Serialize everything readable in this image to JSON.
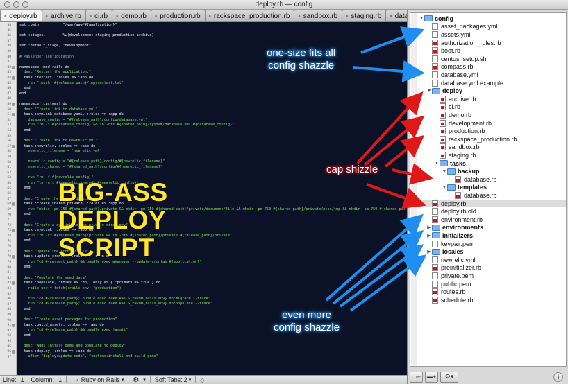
{
  "window": {
    "title": "deploy.rb — config"
  },
  "tabs": [
    {
      "label": "deploy.rb",
      "active": true
    },
    {
      "label": "archive.rb"
    },
    {
      "label": "ci.rb"
    },
    {
      "label": "demo.rb"
    },
    {
      "label": "production.rb"
    },
    {
      "label": "rackspace_production.rb"
    },
    {
      "label": "sandbox.rb"
    },
    {
      "label": "staging.rb"
    },
    {
      "label": "database.rb"
    }
  ],
  "editor": {
    "overlay": [
      "BIG-ASS",
      "DEPLOY",
      "SCRIPT"
    ],
    "lines": [
      {
        "n": "34",
        "text": "set :path,          \"/var/www/#{application}\"",
        "cls": "kw"
      },
      {
        "n": "35",
        "text": "",
        "cls": "kw"
      },
      {
        "n": "36",
        "text": "set :stages,        %w(development staging production archive)",
        "cls": "kw"
      },
      {
        "n": "37",
        "text": "",
        "cls": "kw"
      },
      {
        "n": "38",
        "text": "set :default_stage, \"development\"",
        "cls": "kw"
      },
      {
        "n": "39",
        "text": "",
        "cls": "kw"
      },
      {
        "n": "40",
        "text": "# Passenger Configuration",
        "cls": "cm"
      },
      {
        "n": "41",
        "text": "",
        "cls": "kw"
      },
      {
        "n": "42",
        "text": "namespace :mod_rails do",
        "cls": "kw",
        "fold": true
      },
      {
        "n": "43",
        "text": "  desc \"Restart the application.\"",
        "cls": "st"
      },
      {
        "n": "44",
        "text": "  task :restart, :roles => :app do",
        "cls": "kw",
        "fold": true
      },
      {
        "n": "45",
        "text": "    run \"touch  #{release_path}/tmp/restart.txt\"",
        "cls": "st"
      },
      {
        "n": "46",
        "text": "  end",
        "cls": "kw"
      },
      {
        "n": "47",
        "text": "end",
        "cls": "kw"
      },
      {
        "n": "48",
        "text": "",
        "cls": "kw"
      },
      {
        "n": "49",
        "text": "namespace(:customs) do",
        "cls": "kw",
        "fold": true
      },
      {
        "n": "50",
        "text": "  desc \"Create link to database.yml\"",
        "cls": "st"
      },
      {
        "n": "51",
        "text": "  task :symlink_database_yaml, :roles => :app do",
        "cls": "kw",
        "fold": true
      },
      {
        "n": "52",
        "text": "    database_config = \"#{release_path}/config/database.yml\"",
        "cls": "st"
      },
      {
        "n": "53",
        "text": "    run \"rm -f #{database_config} && ln -nfs #{shared_path}/system/database.yml #{database_config}\"",
        "cls": "st"
      },
      {
        "n": "54",
        "text": "  end",
        "cls": "kw"
      },
      {
        "n": "55",
        "text": "",
        "cls": "kw"
      },
      {
        "n": "56",
        "text": "  desc \"Create link to newrelic.yml\"",
        "cls": "st"
      },
      {
        "n": "57",
        "text": "  task :newrelic, :roles => :app do",
        "cls": "kw",
        "fold": true
      },
      {
        "n": "58",
        "text": "    newrelic_filename = 'newrelic.yml'",
        "cls": "st"
      },
      {
        "n": "59",
        "text": "",
        "cls": "kw"
      },
      {
        "n": "60",
        "text": "    newrelic_config = \"#{release_path}/config/#{newrelic_filename}\"",
        "cls": "st"
      },
      {
        "n": "61",
        "text": "    newrelic_shared = \"#{shared_path}/config/#{newrelic_filename}\"",
        "cls": "st"
      },
      {
        "n": "62",
        "text": "",
        "cls": "kw"
      },
      {
        "n": "63",
        "text": "    run \"rm -f #{newrelic_config}\"",
        "cls": "st"
      },
      {
        "n": "64",
        "text": "    run \"ln -nfs #{newrelic_shared} #{newrelic_config}\"",
        "cls": "st"
      },
      {
        "n": "65",
        "text": "  end",
        "cls": "kw"
      },
      {
        "n": "66",
        "text": "",
        "cls": "kw"
      },
      {
        "n": "67",
        "text": "  desc \"Create the shared directories\"",
        "cls": "st"
      },
      {
        "n": "68",
        "text": "  task :create_shared_private, :roles => :app do",
        "cls": "kw",
        "fold": true
      },
      {
        "n": "69",
        "text": "    run \"mkdir -pm 750 #{shared_path}/private && mkdir -pm 750 #{shared_path}/private/document/file && mkdir -pm 750 #{shared_path}/private/ptos/tmp && mkdir -pm 750 #{shared_path}/private/\"",
        "cls": "st"
      },
      {
        "n": "70",
        "text": "  end",
        "cls": "kw"
      },
      {
        "n": "71",
        "text": "",
        "cls": "kw"
      },
      {
        "n": "72",
        "text": "  desc \"Create a symlink to the private directory\"",
        "cls": "st"
      },
      {
        "n": "73",
        "text": "  task :symlink, :roles => :app do",
        "cls": "kw",
        "fold": true
      },
      {
        "n": "74",
        "text": "    run \"rm -rf #{release_path}/private && ln -nfs #{shared_path}/private #{release_path}/private\"",
        "cls": "st"
      },
      {
        "n": "75",
        "text": "  end",
        "cls": "kw"
      },
      {
        "n": "76",
        "text": "",
        "cls": "kw"
      },
      {
        "n": "77",
        "text": "  desc \"Update the crontab file\"",
        "cls": "st"
      },
      {
        "n": "78",
        "text": "  task :update_crontab, :roles => :cron do",
        "cls": "kw",
        "fold": true
      },
      {
        "n": "79",
        "text": "    run \"cd #{current_path} && bundle exec whenever --update-crontab #{application}\"",
        "cls": "st"
      },
      {
        "n": "80",
        "text": "  end",
        "cls": "kw"
      },
      {
        "n": "81",
        "text": "",
        "cls": "kw"
      },
      {
        "n": "82",
        "text": "  desc \"Populate the seed data\"",
        "cls": "st"
      },
      {
        "n": "83",
        "text": "  task :populate, :roles => :db, :only => { :primary => true } do",
        "cls": "kw",
        "fold": true
      },
      {
        "n": "84",
        "text": "    rails_env = fetch(:rails_env, \"production\")",
        "cls": "st"
      },
      {
        "n": "85",
        "text": "",
        "cls": "kw"
      },
      {
        "n": "86",
        "text": "    run \"cd #{release_path}; bundle exec rake RAILS_ENV=#{rails_env} db:migrate --trace\"",
        "cls": "st"
      },
      {
        "n": "87",
        "text": "    run \"cd #{release_path}; bundle exec rake RAILS_ENV=#{rails_env} db:populate --trace\"",
        "cls": "st"
      },
      {
        "n": "88",
        "text": "  end",
        "cls": "kw"
      },
      {
        "n": "89",
        "text": "",
        "cls": "kw"
      },
      {
        "n": "90",
        "text": "  desc \"Create asset packages for production\"",
        "cls": "st"
      },
      {
        "n": "91",
        "text": "  task :build_assets, :roles => :app do",
        "cls": "kw",
        "fold": true
      },
      {
        "n": "92",
        "text": "    run \"cd #{release_path} && bundle exec jammit\"",
        "cls": "st"
      },
      {
        "n": "93",
        "text": "  end",
        "cls": "kw"
      },
      {
        "n": "94",
        "text": "",
        "cls": "kw"
      },
      {
        "n": "95",
        "text": "  desc \"Adds install gems and populate to deploy\"",
        "cls": "st"
      },
      {
        "n": "96",
        "text": "  task :deploy, :roles => :app do",
        "cls": "kw",
        "fold": true
      },
      {
        "n": "97",
        "text": "    after \"deploy:update_code\", \"customs:install_and_build_gems\"",
        "cls": "st"
      }
    ]
  },
  "statusbar": {
    "line": "Line:",
    "line_value": "1",
    "column": "Column:",
    "column_value": "1",
    "language": "Ruby on Rails",
    "tabs_label": "Soft Tabs:",
    "tabs_value": "2"
  },
  "tree": [
    {
      "depth": 0,
      "type": "dir",
      "open": true,
      "label": "config"
    },
    {
      "depth": 1,
      "type": "file",
      "label": "asset_packages.yml"
    },
    {
      "depth": 1,
      "type": "file",
      "label": "assets.yml"
    },
    {
      "depth": 1,
      "type": "rb",
      "label": "authorization_rules.rb"
    },
    {
      "depth": 1,
      "type": "rb",
      "label": "boot.rb"
    },
    {
      "depth": 1,
      "type": "file",
      "label": "centos_setup.sh"
    },
    {
      "depth": 1,
      "type": "rb",
      "label": "compass.rb"
    },
    {
      "depth": 1,
      "type": "file",
      "label": "database.yml"
    },
    {
      "depth": 1,
      "type": "file",
      "label": "database.yml.example"
    },
    {
      "depth": 1,
      "type": "dir",
      "open": true,
      "label": "deploy"
    },
    {
      "depth": 2,
      "type": "rb",
      "label": "archive.rb"
    },
    {
      "depth": 2,
      "type": "rb",
      "label": "ci.rb"
    },
    {
      "depth": 2,
      "type": "rb",
      "label": "demo.rb"
    },
    {
      "depth": 2,
      "type": "rb",
      "label": "development.rb"
    },
    {
      "depth": 2,
      "type": "rb",
      "label": "production.rb"
    },
    {
      "depth": 2,
      "type": "rb",
      "label": "rackspace_production.rb"
    },
    {
      "depth": 2,
      "type": "rb",
      "label": "sandbox.rb"
    },
    {
      "depth": 2,
      "type": "rb",
      "label": "staging.rb"
    },
    {
      "depth": 2,
      "type": "dir",
      "open": true,
      "label": "tasks"
    },
    {
      "depth": 3,
      "type": "dir",
      "open": true,
      "label": "backup"
    },
    {
      "depth": 4,
      "type": "rb",
      "label": "database.rb"
    },
    {
      "depth": 3,
      "type": "dir",
      "open": true,
      "label": "templates"
    },
    {
      "depth": 4,
      "type": "rb",
      "label": "database.rb"
    },
    {
      "depth": 1,
      "type": "rb",
      "label": "deploy.rb",
      "selected": true
    },
    {
      "depth": 1,
      "type": "file",
      "label": "deploy.rb.old"
    },
    {
      "depth": 1,
      "type": "rb",
      "label": "environment.rb"
    },
    {
      "depth": 1,
      "type": "dir",
      "open": false,
      "label": "environments"
    },
    {
      "depth": 1,
      "type": "dir",
      "open": false,
      "label": "initializers"
    },
    {
      "depth": 1,
      "type": "file",
      "label": "keypair.pem"
    },
    {
      "depth": 1,
      "type": "dir",
      "open": false,
      "label": "locales"
    },
    {
      "depth": 1,
      "type": "file",
      "label": "newrelic.yml"
    },
    {
      "depth": 1,
      "type": "rb",
      "label": "preinitializer.rb"
    },
    {
      "depth": 1,
      "type": "file",
      "label": "private.pem"
    },
    {
      "depth": 1,
      "type": "file",
      "label": "public.pem"
    },
    {
      "depth": 1,
      "type": "rb",
      "label": "routes.rb"
    },
    {
      "depth": 1,
      "type": "rb",
      "label": "schedule.rb"
    }
  ],
  "drawer_footer": {
    "new_file": "+",
    "new_folder": "+",
    "action": "⚙▾",
    "info": "i"
  },
  "annotations": {
    "one_size": [
      "one-size fits all",
      "config shazzle"
    ],
    "cap": "cap shizzle",
    "even_more": [
      "even more",
      "config shazzle"
    ],
    "colors": {
      "blue": "#1e8ef0",
      "red": "#e01818"
    }
  }
}
